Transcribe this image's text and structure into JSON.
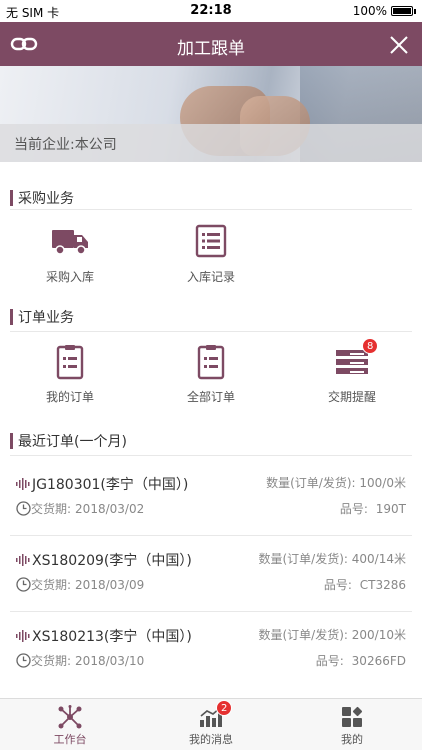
{
  "status_bar": {
    "carrier": "无 SIM 卡",
    "time": "22:18",
    "battery": "100%"
  },
  "nav": {
    "title": "加工跟单"
  },
  "company": {
    "label": "当前企业:本公司"
  },
  "sections": {
    "purchase": {
      "title": "采购业务",
      "items": [
        {
          "label": "采购入库",
          "icon": "truck-icon"
        },
        {
          "label": "入库记录",
          "icon": "list-icon"
        }
      ]
    },
    "order": {
      "title": "订单业务",
      "items": [
        {
          "label": "我的订单",
          "icon": "clipboard-icon"
        },
        {
          "label": "全部订单",
          "icon": "clipboard-icon"
        },
        {
          "label": "交期提醒",
          "icon": "reminder-icon",
          "badge": "8"
        }
      ]
    },
    "recent": {
      "title": "最近订单(一个月)"
    }
  },
  "orders": [
    {
      "code": "JG180301(李宁（中国）)",
      "date_label": "交货期:",
      "date": "2018/03/02",
      "qty_label": "数量(订单/发货):",
      "qty": "100/0米",
      "sku_label": "品号:",
      "sku": "190T"
    },
    {
      "code": "XS180209(李宁（中国）)",
      "date_label": "交货期:",
      "date": "2018/03/09",
      "qty_label": "数量(订单/发货):",
      "qty": "400/14米",
      "sku_label": "品号:",
      "sku": "CT3286"
    },
    {
      "code": "XS180213(李宁（中国）)",
      "date_label": "交货期:",
      "date": "2018/03/10",
      "qty_label": "数量(订单/发货):",
      "qty": "200/10米",
      "sku_label": "品号:",
      "sku": "30266FD"
    }
  ],
  "tabs": [
    {
      "label": "工作台",
      "icon": "workbench-icon",
      "active": true
    },
    {
      "label": "我的消息",
      "icon": "messages-icon",
      "badge": "2"
    },
    {
      "label": "我的",
      "icon": "profile-icon"
    }
  ],
  "colors": {
    "accent": "#7d4a63",
    "badge": "#e53030"
  }
}
